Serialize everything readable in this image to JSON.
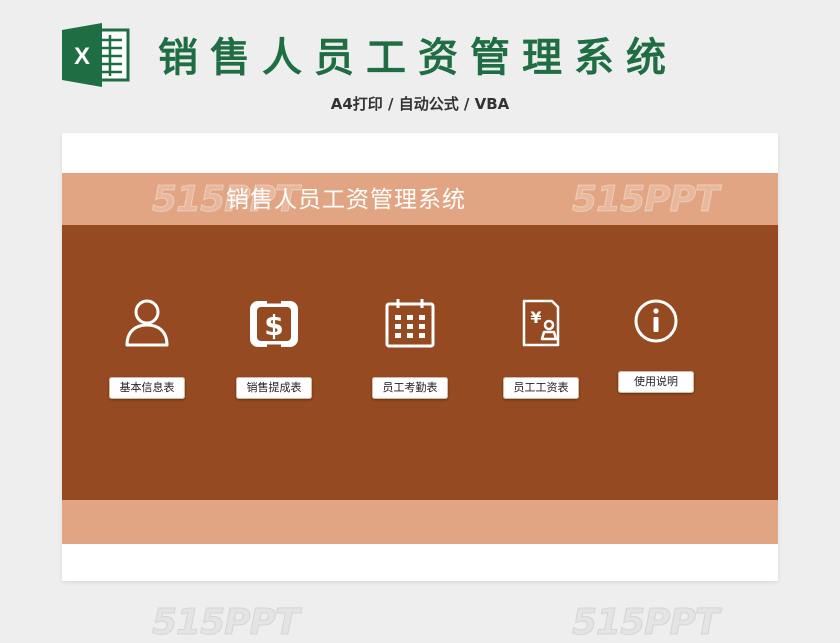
{
  "header": {
    "logo_letter": "X",
    "title": "销售人员工资管理系统",
    "subtitle": "A4打印 / 自动公式 / VBA"
  },
  "panel": {
    "band_title": "销售人员工资管理系统",
    "watermark": "515PPT"
  },
  "menu": [
    {
      "label": "基本信息表",
      "icon": "person-icon"
    },
    {
      "label": "销售提成表",
      "icon": "dollar-icon"
    },
    {
      "label": "员工考勤表",
      "icon": "calendar-icon"
    },
    {
      "label": "员工工资表",
      "icon": "payslip-yen-icon"
    },
    {
      "label": "使用说明",
      "icon": "info-icon"
    }
  ],
  "colors": {
    "excel_green": "#1f6e43",
    "band_light": "#e2a583",
    "main_brown": "#954a22",
    "panel_white": "#ffffff",
    "page_bg": "#eeeeee"
  }
}
